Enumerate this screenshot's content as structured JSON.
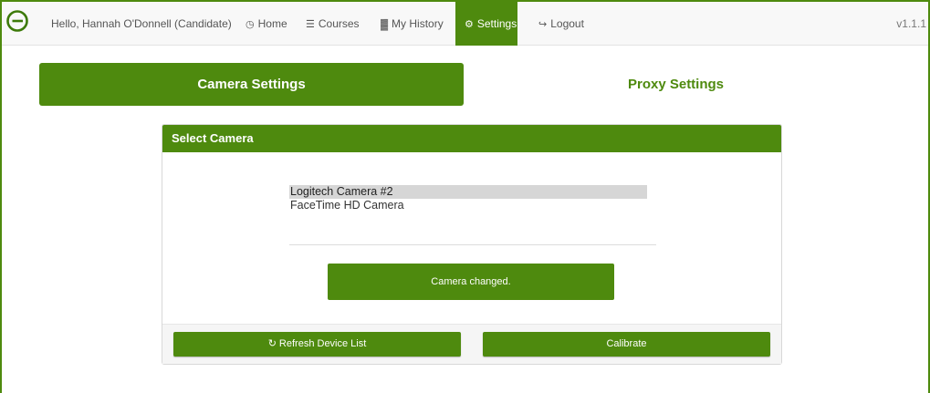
{
  "navbar": {
    "greeting": "Hello, Hannah O'Donnell (Candidate)",
    "items": [
      {
        "label": "Home",
        "icon": "clock-icon",
        "glyph": "◷"
      },
      {
        "label": "Courses",
        "icon": "list-icon",
        "glyph": "☰"
      },
      {
        "label": "My History",
        "icon": "bar-chart-icon",
        "glyph": "▓"
      },
      {
        "label": "Settings",
        "icon": "gear-icon",
        "glyph": "⚙",
        "active": true
      },
      {
        "label": "Logout",
        "icon": "logout-icon",
        "glyph": "↪"
      }
    ],
    "version": "v1.1.1"
  },
  "tabs": [
    {
      "label": "Camera Settings",
      "active": true
    },
    {
      "label": "Proxy Settings",
      "active": false
    }
  ],
  "panel": {
    "title": "Select Camera",
    "cameras": [
      {
        "label": "Logitech Camera #2",
        "selected": true
      },
      {
        "label": "FaceTime HD Camera",
        "selected": false
      }
    ],
    "status_message": "Camera changed.",
    "buttons": {
      "refresh": {
        "label": "Refresh Device List",
        "icon": "refresh-icon",
        "glyph": "↻"
      },
      "calibrate": {
        "label": "Calibrate"
      }
    }
  },
  "colors": {
    "brand": "#4e8a0e",
    "navbar_bg": "#f8f8f8",
    "selected_option": "#d6d6d6"
  }
}
